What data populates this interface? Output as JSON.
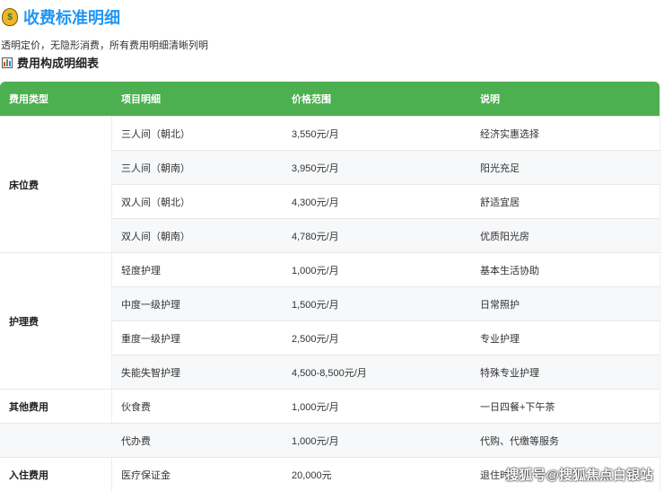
{
  "title": "收费标准明细",
  "subtitle": "透明定价，无隐形消费，所有费用明细清晰列明",
  "table_title": "费用构成明细表",
  "headers": [
    "费用类型",
    "项目明细",
    "价格范围",
    "说明"
  ],
  "rows": [
    {
      "item": "三人间（朝北）",
      "price": "3,550元/月",
      "note": "经济实惠选择"
    },
    {
      "item": "三人间（朝南）",
      "price": "3,950元/月",
      "note": "阳光充足"
    },
    {
      "item": "双人间（朝北）",
      "price": "4,300元/月",
      "note": "舒适宜居"
    },
    {
      "item": "双人间（朝南）",
      "price": "4,780元/月",
      "note": "优质阳光房"
    },
    {
      "item": "轻度护理",
      "price": "1,000元/月",
      "note": "基本生活协助"
    },
    {
      "item": "中度一级护理",
      "price": "1,500元/月",
      "note": "日常照护"
    },
    {
      "item": "重度一级护理",
      "price": "2,500元/月",
      "note": "专业护理"
    },
    {
      "item": "失能失智护理",
      "price": "4,500-8,500元/月",
      "note": "特殊专业护理"
    },
    {
      "item": "伙食费",
      "price": "1,000元/月",
      "note": "一日四餐+下午茶"
    },
    {
      "item": "代办费",
      "price": "1,000元/月",
      "note": "代购、代缴等服务"
    },
    {
      "item": "医疗保证金",
      "price": "20,000元",
      "note": "退住时"
    }
  ],
  "types": [
    "床位费",
    "护理费",
    "其他费用",
    "入住费用"
  ],
  "watermark": "搜狐号@搜狐焦点白银站",
  "colors": {
    "accent": "#2196f3",
    "header": "#4caf50"
  }
}
